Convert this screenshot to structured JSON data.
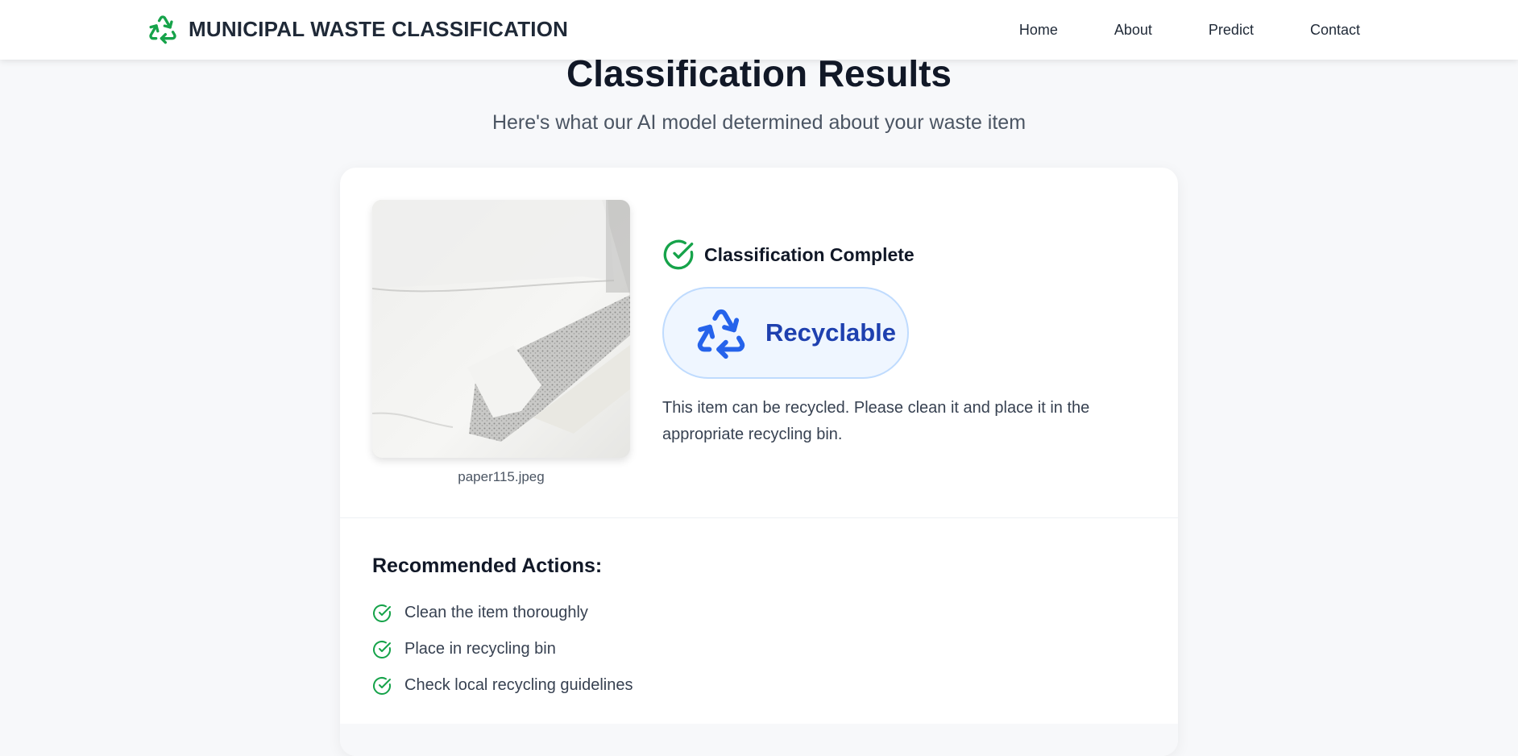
{
  "nav": {
    "brand_icon": "recycle-icon",
    "brand_title": "MUNICIPAL WASTE CLASSIFICATION",
    "links": [
      "Home",
      "About",
      "Predict",
      "Contact"
    ]
  },
  "header": {
    "title": "Classification Results",
    "subtitle": "Here's what our AI model determined about your waste item"
  },
  "result": {
    "filename": "paper115.jpeg",
    "status_icon": "check-circle-icon",
    "status": "Classification Complete",
    "category_icon": "recycle-icon",
    "category": "Recyclable",
    "description": "This item can be recycled. Please clean it and place it in the appropriate recycling bin."
  },
  "actions": {
    "title": "Recommended Actions:",
    "items": [
      "Clean the item thoroughly",
      "Place in recycling bin",
      "Check local recycling guidelines"
    ]
  },
  "colors": {
    "brand_green": "#16a34a",
    "recycle_blue": "#2563eb",
    "recyclable_text": "#1e40af",
    "pill_bg": "#eff6ff",
    "pill_border": "#bfdbfe"
  }
}
